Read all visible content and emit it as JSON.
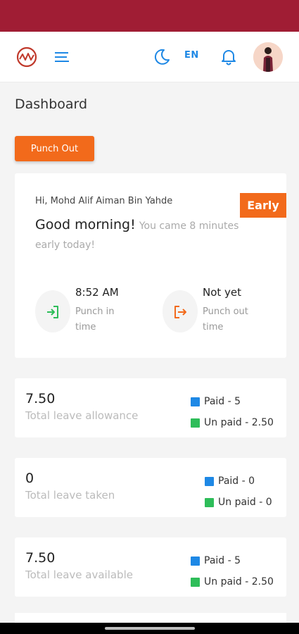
{
  "header": {
    "language": "EN",
    "icons": [
      "app-logo-icon",
      "menu-icon",
      "dark-mode-moon-icon",
      "notification-bell-icon",
      "profile-avatar"
    ]
  },
  "page": {
    "title": "Dashboard"
  },
  "actions": {
    "punch_out_label": "Punch Out"
  },
  "welcome": {
    "greeting_name": "Hi, Mohd Alif Aiman Bin Yahde",
    "greeting": "Good morning!",
    "subtitle": "You came 8 minutes early today!",
    "badge": "Early",
    "punch_in": {
      "time": "8:52 AM",
      "label": "Punch in time"
    },
    "punch_out": {
      "time": "Not yet",
      "label": "Punch out time"
    }
  },
  "stats": [
    {
      "value": "7.50",
      "caption": "Total leave allowance",
      "paid": "Paid - 5",
      "unpaid": "Un paid - 2.50"
    },
    {
      "value": "0",
      "caption": "Total leave taken",
      "paid": "Paid - 0",
      "unpaid": "Un paid - 0"
    },
    {
      "value": "7.50",
      "caption": "Total leave available",
      "paid": "Paid - 5",
      "unpaid": "Un paid - 2.50"
    }
  ],
  "colors": {
    "status_bar": "#a01d34",
    "accent_orange": "#f26a1b",
    "accent_blue": "#1e88e5",
    "paid": "#1e88e5",
    "unpaid": "#2ebd59"
  }
}
